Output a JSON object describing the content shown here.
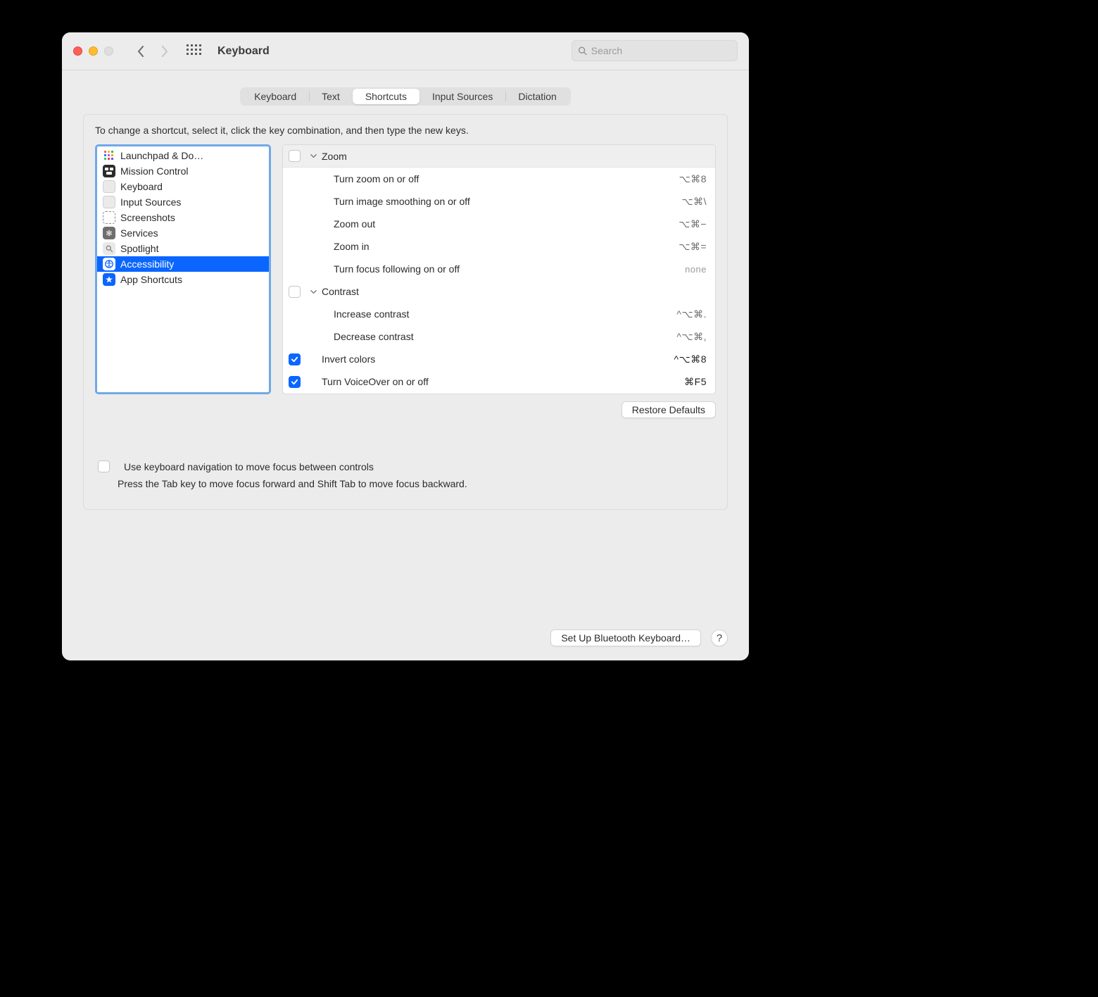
{
  "window": {
    "title": "Keyboard"
  },
  "search": {
    "placeholder": "Search"
  },
  "tabs": [
    {
      "label": "Keyboard"
    },
    {
      "label": "Text"
    },
    {
      "label": "Shortcuts",
      "active": true
    },
    {
      "label": "Input Sources"
    },
    {
      "label": "Dictation"
    }
  ],
  "hint": "To change a shortcut, select it, click the key combination, and then type the new keys.",
  "categories": [
    {
      "label": "Launchpad & Do…",
      "icon": "launchpad"
    },
    {
      "label": "Mission Control",
      "icon": "mission-control"
    },
    {
      "label": "Keyboard",
      "icon": "keyboard"
    },
    {
      "label": "Input Sources",
      "icon": "input-sources"
    },
    {
      "label": "Screenshots",
      "icon": "screenshots"
    },
    {
      "label": "Services",
      "icon": "services"
    },
    {
      "label": "Spotlight",
      "icon": "spotlight"
    },
    {
      "label": "Accessibility",
      "icon": "accessibility",
      "selected": true
    },
    {
      "label": "App Shortcuts",
      "icon": "app-shortcuts"
    }
  ],
  "shortcuts": {
    "groups": [
      {
        "label": "Zoom",
        "checked": false,
        "items": [
          {
            "label": "Turn zoom on or off",
            "key": "⌥⌘8"
          },
          {
            "label": "Turn image smoothing on or off",
            "key": "⌥⌘\\"
          },
          {
            "label": "Zoom out",
            "key": "⌥⌘−"
          },
          {
            "label": "Zoom in",
            "key": "⌥⌘="
          },
          {
            "label": "Turn focus following on or off",
            "key": "none",
            "none": true
          }
        ]
      },
      {
        "label": "Contrast",
        "checked": false,
        "items": [
          {
            "label": "Increase contrast",
            "key": "^⌥⌘."
          },
          {
            "label": "Decrease contrast",
            "key": "^⌥⌘,"
          }
        ]
      }
    ],
    "top_items": [
      {
        "label": "Invert colors",
        "key": "^⌥⌘8",
        "checked": true
      },
      {
        "label": "Turn VoiceOver on or off",
        "key": "⌘F5",
        "checked": true
      }
    ]
  },
  "restore_defaults": "Restore Defaults",
  "kbnav": {
    "label": "Use keyboard navigation to move focus between controls",
    "sub": "Press the Tab key to move focus forward and Shift Tab to move focus backward."
  },
  "bluetooth_button": "Set Up Bluetooth Keyboard…",
  "help": "?"
}
